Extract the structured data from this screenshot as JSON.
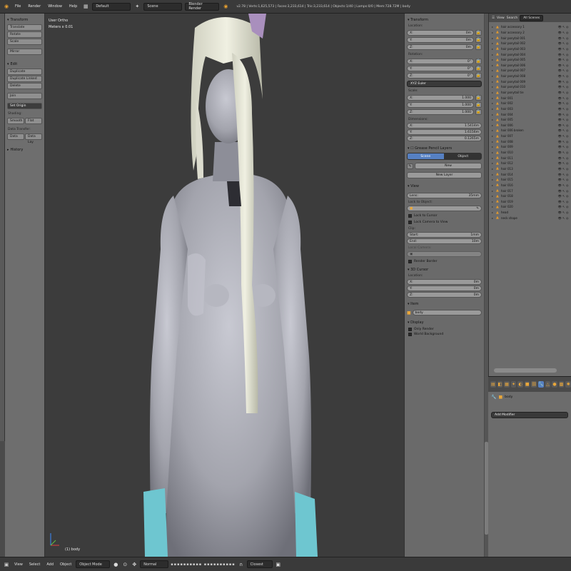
{
  "top_header": {
    "menus": [
      "File",
      "Render",
      "Window",
      "Help"
    ],
    "layout": "Default",
    "scene": "Scene",
    "engine": "Blender Render",
    "stats": "v2.78 | Verts:1,625,573 | Faces:3,233,614 | Tris:3,233,614 | Objects:1/40 | Lamps:0/0 | Mem:728.72M | body"
  },
  "tool_shelf": {
    "transform_header": "Transform",
    "transform_buttons": [
      "Translate",
      "Rotate",
      "Scale",
      "Mirror"
    ],
    "edit_header": "Edit",
    "edit_buttons": [
      "Duplicate",
      "Duplicate Linked",
      "Delete",
      "Join"
    ],
    "set_origin": "Set Origin",
    "shading_label": "Shading:",
    "smooth": "Smooth",
    "flat": "Flat",
    "data_transfer_label": "Data Transfer:",
    "data": "Data",
    "data_lay": "Data Lay",
    "history": "History"
  },
  "viewport": {
    "view_name": "User Ortho",
    "units": "Meters x 0.01",
    "object_label": "(1) body",
    "skin_color": "#a9aab2",
    "bg_color": "#3c3c3c"
  },
  "properties": {
    "transform_header": "Transform",
    "location_label": "Location:",
    "location": [
      {
        "axis": "X:",
        "value": "0m"
      },
      {
        "axis": "Y:",
        "value": "0m"
      },
      {
        "axis": "Z:",
        "value": "0m"
      }
    ],
    "rotation_label": "Rotation:",
    "rotation": [
      {
        "axis": "X:",
        "value": "0°"
      },
      {
        "axis": "Y:",
        "value": "0°"
      },
      {
        "axis": "Z:",
        "value": "0°"
      }
    ],
    "rotation_mode": "XYZ Euler",
    "scale_label": "Scale:",
    "scale": [
      {
        "axis": "X:",
        "value": "1.000"
      },
      {
        "axis": "Y:",
        "value": "1.000"
      },
      {
        "axis": "Z:",
        "value": "1.000"
      }
    ],
    "dimensions_label": "Dimensions:",
    "dimensions": [
      {
        "axis": "X:",
        "value": "1.5414m"
      },
      {
        "axis": "Y:",
        "value": "1.6156m"
      },
      {
        "axis": "Z:",
        "value": "0.1265m"
      }
    ],
    "grease_pencil_header": "Grease Pencil Layers",
    "scene_tab": "Scene",
    "object_tab": "Object",
    "new_button": "New",
    "new_layer_button": "New Layer",
    "view_header": "View",
    "lens_label": "Lens:",
    "lens_value": "35mm",
    "lock_to_object": "Lock to Object:",
    "lock_to_cursor": "Lock to Cursor",
    "lock_camera": "Lock Camera to View",
    "clip_label": "Clip:",
    "clip_start_label": "Start:",
    "clip_start": "1mm",
    "clip_end_label": "End:",
    "clip_end": "10m",
    "local_camera": "Local Camera:",
    "render_border": "Render Border",
    "cursor_header": "3D Cursor",
    "cursor_location_label": "Location:",
    "cursor_location": [
      {
        "axis": "X:",
        "value": "0m"
      },
      {
        "axis": "Y:",
        "value": "0m"
      },
      {
        "axis": "Z:",
        "value": "0m"
      }
    ],
    "item_header": "Item",
    "item_name": "body",
    "display_header": "Display",
    "only_render": "Only Render",
    "world_background": "World Background"
  },
  "outliner": {
    "view": "View",
    "search": "Search",
    "filter": "All Scenes",
    "items": [
      "hair accessory 1",
      "hair accessory 2",
      "hair ponytail 001",
      "hair ponytail 002",
      "hair ponytail 003",
      "hair ponytail 004",
      "hair ponytail 005",
      "hair ponytail 006",
      "hair ponytail 007",
      "hair ponytail 008",
      "hair ponytail 009",
      "hair ponytail 010",
      "hair ponytail tie",
      "hair 001",
      "hair 002",
      "hair 003",
      "hair 004",
      "hair 005",
      "hair 006",
      "hair 006 broken",
      "hair 007",
      "hair 008",
      "hair 009",
      "hair 010",
      "hair 011",
      "hair 012",
      "hair 013",
      "hair 014",
      "hair 015",
      "hair 016",
      "hair 017",
      "hair 018",
      "hair 019",
      "hair 020",
      "head",
      "neck shape"
    ]
  },
  "properties_editor": {
    "object_name": "body",
    "add_modifier": "Add Modifier"
  },
  "bottom_header": {
    "menus": [
      "View",
      "Select",
      "Add",
      "Object"
    ],
    "mode": "Object Mode",
    "pivot": "Normal",
    "snap": "Closest"
  }
}
